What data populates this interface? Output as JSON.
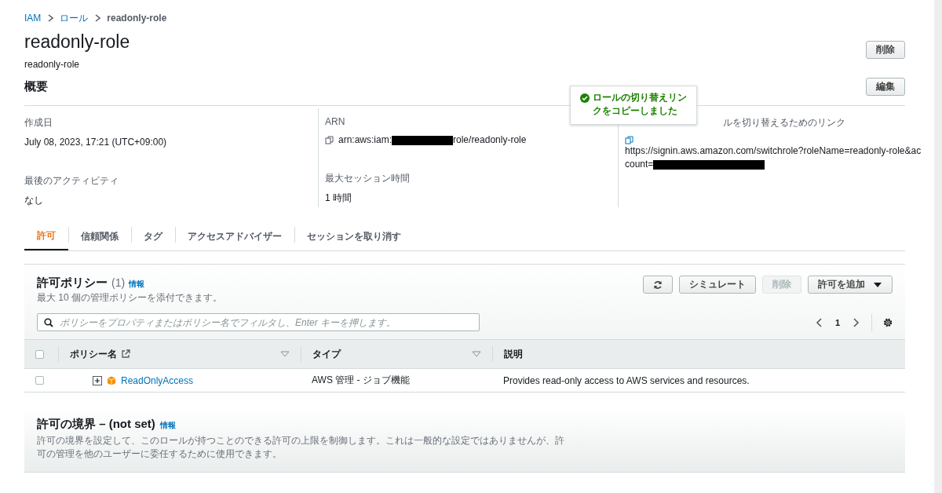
{
  "breadcrumb": [
    {
      "label": "IAM",
      "link": true
    },
    {
      "label": "ロール",
      "link": true
    },
    {
      "label": "readonly-role",
      "link": false
    }
  ],
  "title": "readonly-role",
  "subtitle": "readonly-role",
  "delete_button": "削除",
  "summary": {
    "heading": "概要",
    "edit_button": "編集",
    "columns": [
      [
        {
          "label": "作成日",
          "value": [
            {
              "text": "July 08, 2023, 17:21 (UTC+09:00)"
            }
          ],
          "copy": false
        },
        {
          "label": "最後のアクティビティ",
          "value": [
            {
              "text": "なし"
            }
          ],
          "copy": false
        }
      ],
      [
        {
          "label": "ARN",
          "value": [
            {
              "text": "arn:aws:iam:"
            },
            {
              "kind": "redacted"
            },
            {
              "text": "role/readonly-role"
            }
          ],
          "copy": true
        },
        {
          "label": "最大セッション時間",
          "value": [
            {
              "text": "1 時間"
            }
          ],
          "copy": false
        }
      ],
      [
        {
          "label": "ルを切り替えるためのリンク",
          "value": [
            {
              "text": "https://signin.aws.amazon.com/switchrole?roleName=readonly-role&ac"
            },
            {
              "kind": "break"
            },
            {
              "text": "count="
            },
            {
              "kind": "redacted"
            }
          ],
          "copy": true,
          "tooltip": "ロールの切り替えリンクをコピーしました"
        }
      ]
    ]
  },
  "tabs": [
    {
      "label": "許可",
      "selected": true
    },
    {
      "label": "信頼関係",
      "selected": false
    },
    {
      "label": "タグ",
      "selected": false
    },
    {
      "label": "アクセスアドバイザー",
      "selected": false
    },
    {
      "label": "セッションを取り消す",
      "selected": false
    }
  ],
  "policies": {
    "title": "許可ポリシー",
    "count": "(1)",
    "info": "情報",
    "description": "最大 10 個の管理ポリシーを添付できます。",
    "select_all_checked": false,
    "buttons": [
      {
        "kind": "refresh",
        "disabled": false
      },
      {
        "kind": "text",
        "label": "シミュレート",
        "disabled": false
      },
      {
        "kind": "text",
        "label": "削除",
        "disabled": true
      },
      {
        "kind": "dropdown",
        "label": "許可を追加",
        "disabled": false
      }
    ],
    "search": {
      "placeholder": "ポリシーをプロパティまたはポリシー名でフィルタし、Enter キーを押します。"
    },
    "page": "1",
    "columns": [
      {
        "label": "ポリシー名",
        "external": true,
        "sortable": true
      },
      {
        "label": "タイプ",
        "external": false,
        "sortable": true
      },
      {
        "label": "説明",
        "external": false,
        "sortable": false
      }
    ],
    "rows": [
      {
        "checked": false,
        "expanded": false,
        "name": "ReadOnlyAccess",
        "type": "AWS 管理 - ジョブ機能",
        "description": "Provides read-only access to AWS services and resources."
      }
    ]
  },
  "boundary": {
    "title": "許可の境界 – (not set)",
    "info": "情報",
    "description": "許可の境界を設定して、このロールが持つことのできる許可の上限を制御します。これは一般的な設定ではありませんが、許可の管理を他のユーザーに委任するために使用できます。"
  }
}
